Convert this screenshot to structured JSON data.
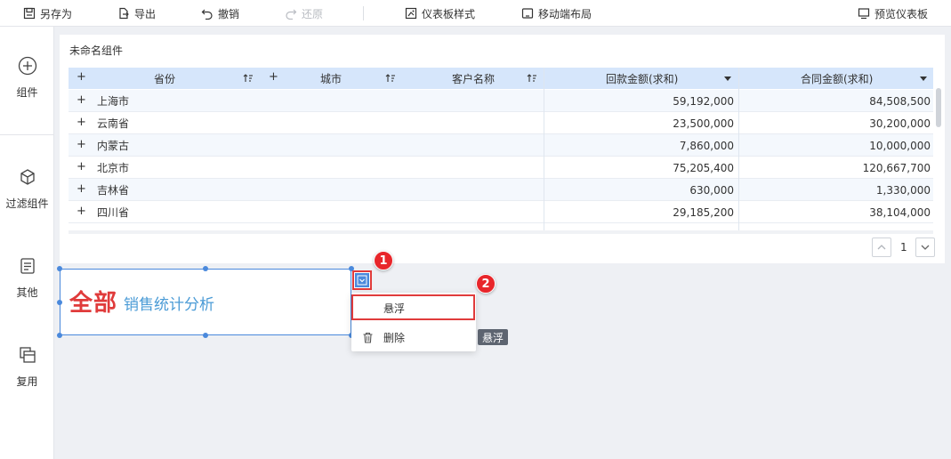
{
  "toolbar": {
    "save_as": "另存为",
    "export": "导出",
    "undo": "撤销",
    "redo": "还原",
    "dashboard_style": "仪表板样式",
    "mobile_layout": "移动端布局",
    "preview": "预览仪表板"
  },
  "sidebar": {
    "items": [
      {
        "label": "组件",
        "icon": "plus-circle-icon"
      },
      {
        "label": "过滤组件",
        "icon": "cube-icon"
      },
      {
        "label": "其他",
        "icon": "document-icon"
      },
      {
        "label": "复用",
        "icon": "layers-icon"
      }
    ]
  },
  "widget": {
    "title": "未命名组件",
    "columns": {
      "province": "省份",
      "city": "城市",
      "customer": "客户名称",
      "payment": "回款金额(求和)",
      "contract": "合同金额(求和)"
    },
    "rows": [
      {
        "province": "上海市",
        "payment": "59,192,000",
        "contract": "84,508,500"
      },
      {
        "province": "云南省",
        "payment": "23,500,000",
        "contract": "30,200,000"
      },
      {
        "province": "内蒙古",
        "payment": "7,860,000",
        "contract": "10,000,000"
      },
      {
        "province": "北京市",
        "payment": "75,205,400",
        "contract": "120,667,700"
      },
      {
        "province": "吉林省",
        "payment": "630,000",
        "contract": "1,330,000"
      },
      {
        "province": "四川省",
        "payment": "29,185,200",
        "contract": "38,104,000"
      }
    ],
    "expand_symbol": "+",
    "page": "1"
  },
  "textbox": {
    "main": "全部",
    "sub": "销售统计分析"
  },
  "context_menu": {
    "float": "悬浮",
    "delete": "删除",
    "tooltip": "悬浮"
  },
  "badges": {
    "first": "1",
    "second": "2"
  },
  "colors": {
    "accent": "#4a89dc",
    "highlight": "#e03b3b",
    "header_bg": "#d6e6fb",
    "title_red": "#e03b3b",
    "subtitle_blue": "#4a9bd6"
  }
}
